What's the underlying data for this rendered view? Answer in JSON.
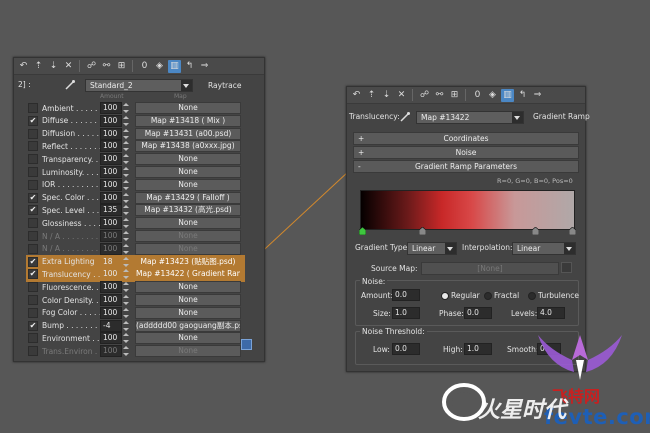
{
  "left_panel": {
    "toolbar_icons": [
      "pick-material-icon",
      "put-to-scene-icon",
      "assign-material-icon",
      "reset-icon",
      "make-copy-icon",
      "make-unique-icon",
      "put-to-library-icon",
      "material-effects-channel-icon",
      "show-in-viewport-icon",
      "show-end-result-icon",
      "go-to-parent-icon",
      "go-forward-icon"
    ],
    "channel_id_label": "0",
    "level_label": "2] :",
    "material_name": "Standard_2",
    "material_type": "Raytrace",
    "header_fragment": "Amount",
    "header_map_fragment": "Map",
    "rows": [
      {
        "label": "Ambient . . . . . . .",
        "checked": false,
        "amount": "100",
        "map": "None",
        "dim": false
      },
      {
        "label": "Diffuse . . . . . . . .",
        "checked": true,
        "amount": "100",
        "map": "Map #13418  ( Mix )",
        "dim": false
      },
      {
        "label": "Diffusion . . . . . . .",
        "checked": false,
        "amount": "100",
        "map": "Map #13431 (a00.psd)",
        "dim": false
      },
      {
        "label": "Reflect . . . . . . . .",
        "checked": false,
        "amount": "100",
        "map": "Map #13438 (a0xxx.jpg)",
        "dim": false
      },
      {
        "label": "Transparency. . . .",
        "checked": false,
        "amount": "100",
        "map": "None",
        "dim": false
      },
      {
        "label": "Luminosity. . . . . . .",
        "checked": false,
        "amount": "100",
        "map": "None",
        "dim": false
      },
      {
        "label": "IOR . . . . . . . . . .",
        "checked": false,
        "amount": "100",
        "map": "None",
        "dim": false
      },
      {
        "label": "Spec. Color . . . .",
        "checked": true,
        "amount": "100",
        "map": "Map #13429  ( Falloff )",
        "dim": false
      },
      {
        "label": "Spec. Level . . . .",
        "checked": true,
        "amount": "135",
        "map": "Map #13432 (高光.psd)",
        "dim": false
      },
      {
        "label": "Glossiness . . . . .",
        "checked": false,
        "amount": "100",
        "map": "None",
        "dim": false
      },
      {
        "label": "N / A . . . . . . . .",
        "checked": false,
        "amount": "100",
        "map": "None",
        "dim": true
      },
      {
        "label": "N / A . . . . . . . .",
        "checked": false,
        "amount": "100",
        "map": "None",
        "dim": true
      },
      {
        "label": "Extra Lighting",
        "checked": true,
        "amount": "18",
        "map": "Map #13423 (贴贴图.psd)",
        "dim": false,
        "highlight": true
      },
      {
        "label": "Translucency . . .",
        "checked": true,
        "amount": "100",
        "map": "Map #13422  ( Gradient Ramp",
        "dim": false,
        "highlight": true
      },
      {
        "label": "Fluorescence. . . .",
        "checked": false,
        "amount": "100",
        "map": "None",
        "dim": false
      },
      {
        "label": "Color Density. . . .",
        "checked": false,
        "amount": "100",
        "map": "None",
        "dim": false
      },
      {
        "label": "Fog Color . . . . . .",
        "checked": false,
        "amount": "100",
        "map": "None",
        "dim": false
      },
      {
        "label": "Bump . . . . . . . . .",
        "checked": true,
        "amount": "-4",
        "map": "(addddd00 gaoguang副本.psd)",
        "dim": false
      },
      {
        "label": "Environment . . . .",
        "checked": false,
        "amount": "100",
        "map": "None",
        "dim": false
      },
      {
        "label": "Trans.Environ . . .",
        "checked": false,
        "amount": "100",
        "map": "None",
        "dim": true
      }
    ]
  },
  "right_panel": {
    "channel_id_label": "0",
    "slot_label": "Translucency:",
    "map_name": "Map #13422",
    "map_type": "Gradient Ramp",
    "rollouts": [
      {
        "pm": "+",
        "title": "Coordinates"
      },
      {
        "pm": "+",
        "title": "Noise"
      },
      {
        "pm": "-",
        "title": "Gradient Ramp Parameters"
      }
    ],
    "rgb_readout": "R=0, G=0, B=0,   Pos=0",
    "gradient_type_label": "Gradient Type:",
    "gradient_type_value": "Linear",
    "interpolation_label": "Interpolation:",
    "interpolation_value": "Linear",
    "source_map_label": "Source Map:",
    "source_map_value": "[None]",
    "noise_group_label": "Noise:",
    "amount_label": "Amount:",
    "amount_value": "0.0",
    "noise_types": [
      "Regular",
      "Fractal",
      "Turbulence"
    ],
    "noise_selected": "Regular",
    "size_label": "Size:",
    "size_value": "1.0",
    "phase_label": "Phase:",
    "phase_value": "0.0",
    "levels_label": "Levels:",
    "levels_value": "4.0",
    "threshold_group_label": "Noise Threshold:",
    "low_label": "Low:",
    "low_value": "0.0",
    "high_label": "High:",
    "high_value": "1.0",
    "smooth_label": "Smooth:",
    "smooth_value": "0."
  },
  "watermark": {
    "brand_cn": "飞特网",
    "url": "fevte.com",
    "logo_text": "火星时代"
  },
  "colors": {
    "highlight": "#c7842f",
    "connector": "#d3892c",
    "active_blue": "#4b87c4"
  }
}
